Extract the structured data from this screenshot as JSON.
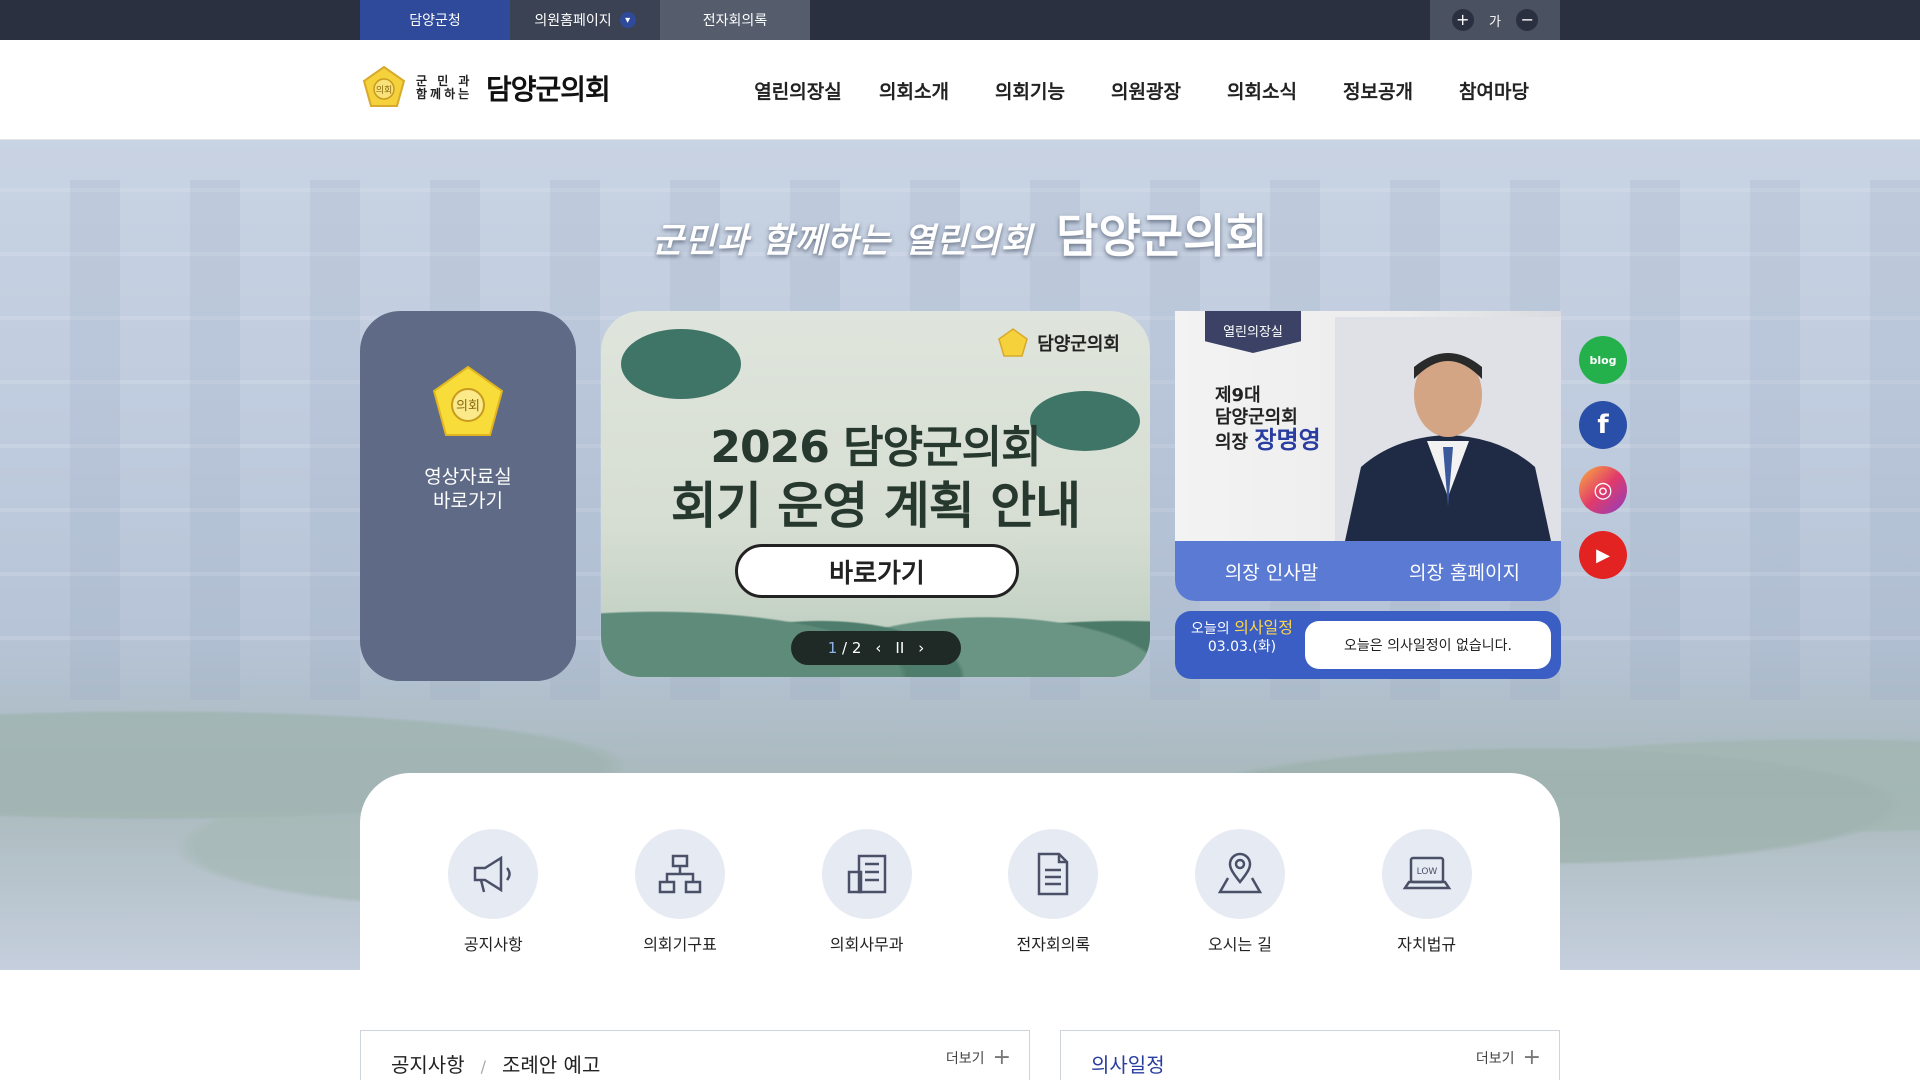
{
  "topbar": {
    "links": [
      "담양군청",
      "의원홈페이지",
      "전자회의록"
    ],
    "font_label": "가",
    "font_plus": "+",
    "font_minus": "−",
    "dropdown_icon": "chevron-down-icon"
  },
  "header": {
    "logo_small": "군 민 과 함께하는",
    "logo_big": "담양군의회",
    "nav": [
      "열린의장실",
      "의회소개",
      "의회기능",
      "의원광장",
      "의회소식",
      "정보공개",
      "참여마당"
    ]
  },
  "hero": {
    "slogan_1": "군민과 함께하는 열린의회",
    "slogan_2": "담양군의회",
    "video_panel": {
      "line1": "영상자료실",
      "line2": "바로가기"
    },
    "banner": {
      "logo_text": "담양군의회",
      "title_1": "2026 담양군의회",
      "title_2": "회기 운영 계획 안내",
      "button": "바로가기",
      "pager_current": "1",
      "pager_total": "/ 2",
      "prev": "‹",
      "pause": "II",
      "next": "›"
    },
    "chairman": {
      "tag": "열린의장실",
      "line1": "제9대",
      "line2": "담양군의회",
      "role": "의장",
      "name": "장명영",
      "btn_greeting": "의장 인사말",
      "btn_home": "의장 홈페이지"
    },
    "schedule": {
      "prefix": "오늘의",
      "highlight": "의사일정",
      "date": "03.03.(화)",
      "message": "오늘은 의사일정이 없습니다."
    },
    "sns": [
      "blog",
      "f",
      "◎",
      "▶"
    ]
  },
  "quick_menu": [
    {
      "label": "공지사항",
      "icon": "megaphone-icon"
    },
    {
      "label": "의회기구표",
      "icon": "org-chart-icon"
    },
    {
      "label": "의회사무과",
      "icon": "office-icon"
    },
    {
      "label": "전자회의록",
      "icon": "document-icon"
    },
    {
      "label": "오시는 길",
      "icon": "map-pin-icon"
    },
    {
      "label": "자치법규",
      "icon": "law-laptop-icon"
    }
  ],
  "boards": {
    "notice": {
      "tab1": "공지사항",
      "sep": "/",
      "tab2": "조례안 예고",
      "more": "더보기"
    },
    "schedule": {
      "title": "의사일정",
      "more": "더보기"
    }
  },
  "colors": {
    "topbar": "#2b3040",
    "accent": "#3b5ec4",
    "video_panel": "#5f6a86"
  }
}
